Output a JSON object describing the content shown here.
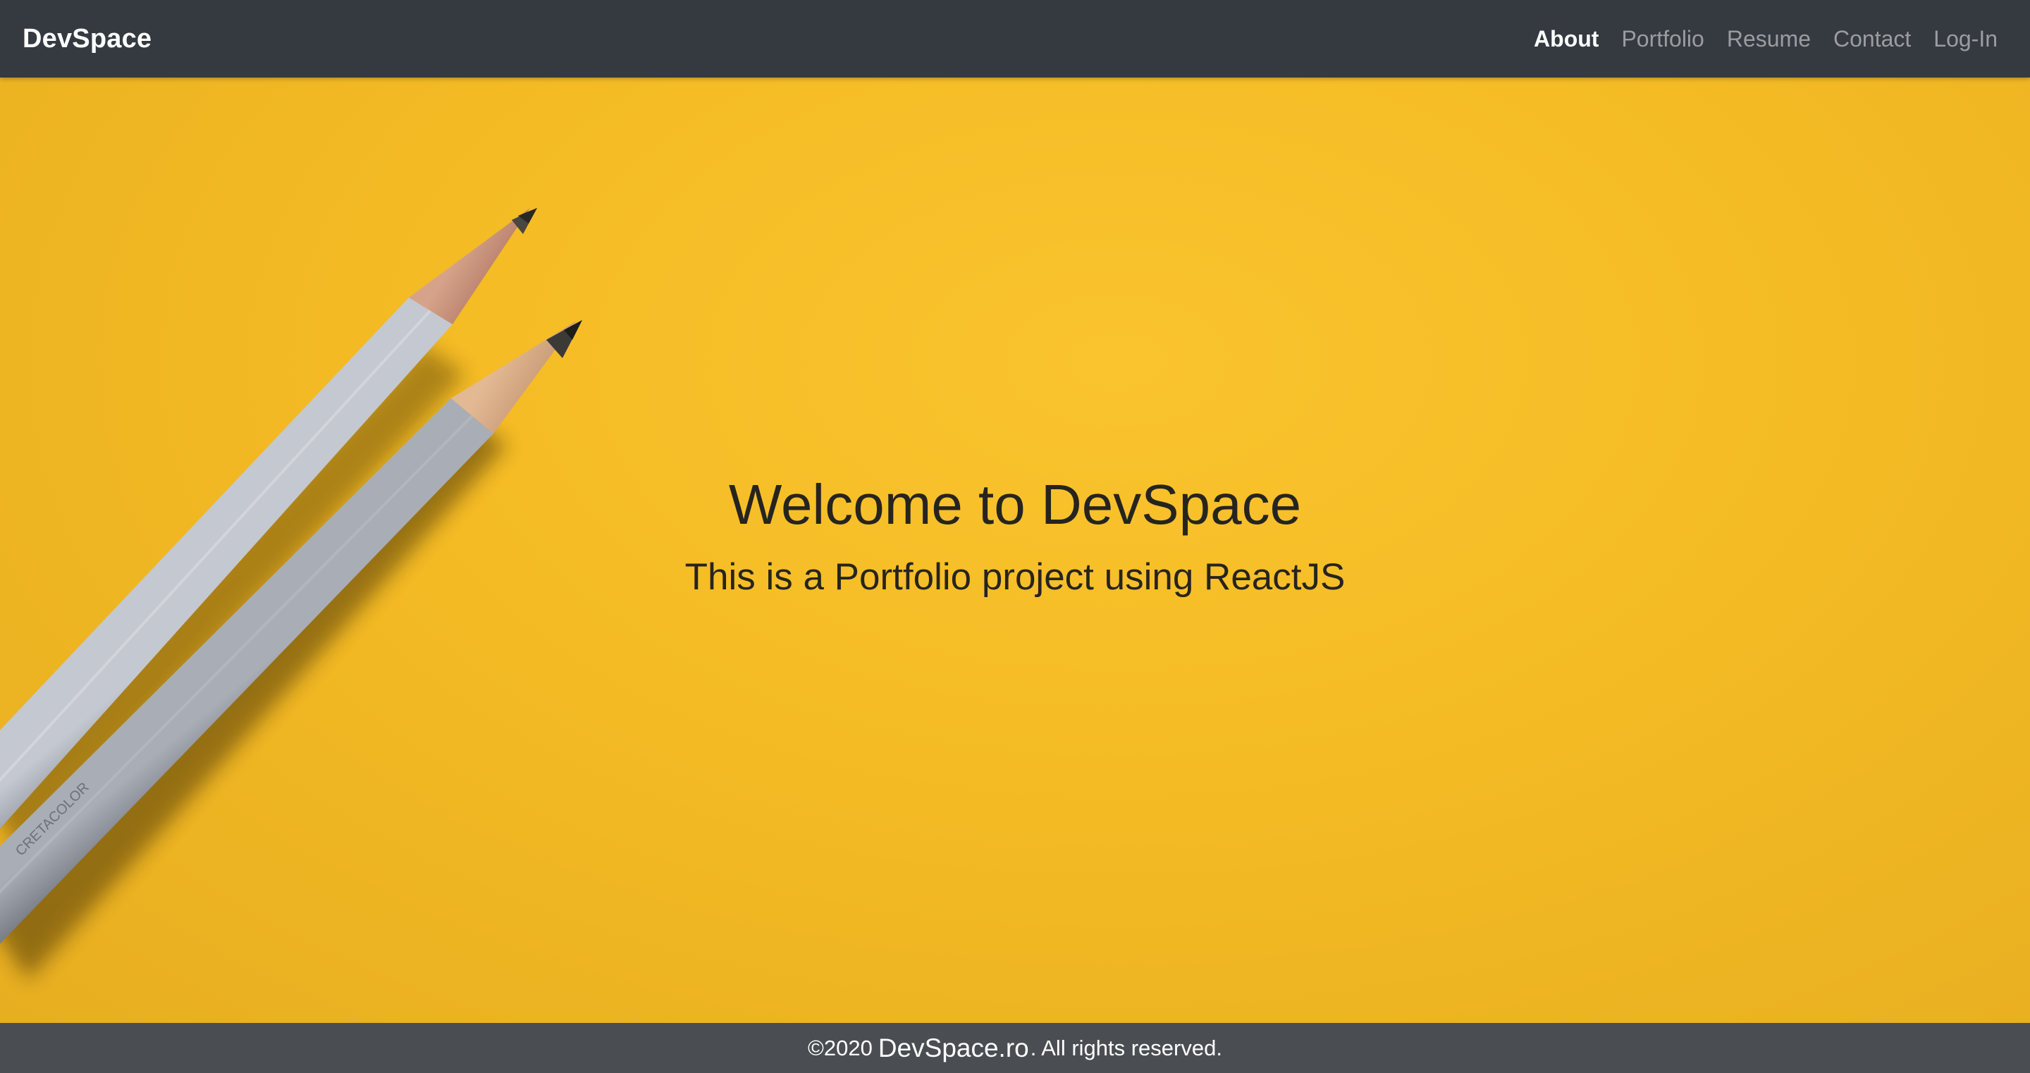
{
  "navbar": {
    "brand": "DevSpace",
    "links": [
      {
        "label": "About",
        "active": true
      },
      {
        "label": "Portfolio",
        "active": false
      },
      {
        "label": "Resume",
        "active": false
      },
      {
        "label": "Contact",
        "active": false
      },
      {
        "label": "Log-In",
        "active": false
      }
    ]
  },
  "hero": {
    "title": "Welcome to DevSpace",
    "subtitle": "This is a Portfolio project using ReactJS",
    "background_color": "#f4bb24",
    "image": "two-grey-pencils-on-yellow-paper"
  },
  "footer": {
    "copyright": "©2020",
    "brand": "DevSpace.ro",
    "rights": ". All rights reserved."
  },
  "colors": {
    "navbar_bg": "#343a40",
    "footer_bg": "#4a4e52",
    "text_dark": "#26241f"
  }
}
